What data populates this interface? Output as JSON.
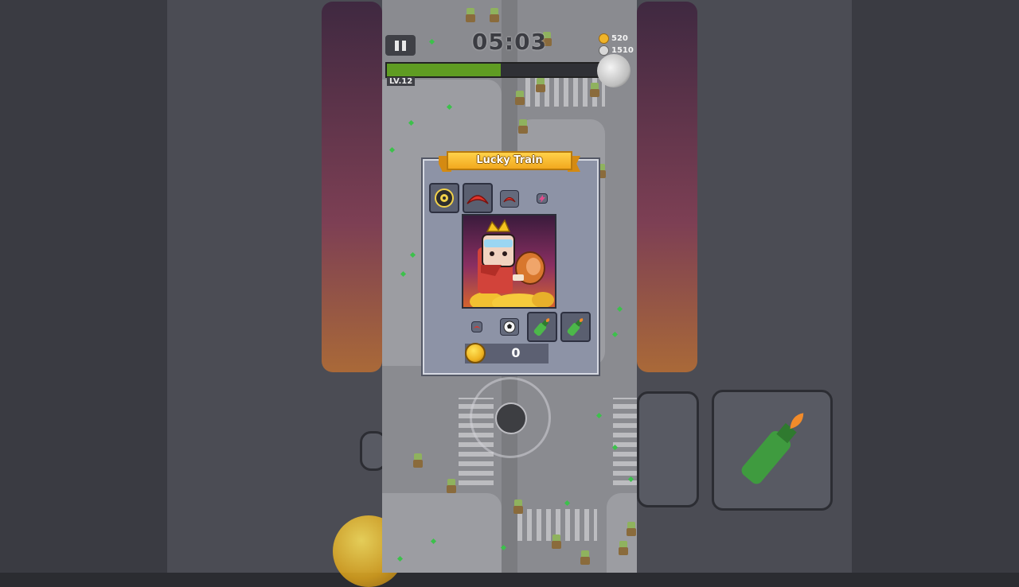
{
  "hud": {
    "timer": "05:03",
    "coins": "520",
    "kills": "1510",
    "level": "LV.12",
    "xp_progress": 0.53
  },
  "dialog": {
    "title": "Lucky Train",
    "coin_amount": "0",
    "top_slots": [
      "shuriken-icon",
      "boomerang-icon",
      "boomerang-icon",
      "lightning-icon"
    ],
    "bottom_slots": [
      "boomerang-icon",
      "soccer-ball-icon",
      "molotov-icon",
      "molotov-icon"
    ],
    "portrait": "king-with-meat-and-gold-icon"
  },
  "colors": {
    "xp_fill": "#5f9c22",
    "title_banner": "#f2a81e",
    "dialog_bg": "#8d93a6"
  }
}
